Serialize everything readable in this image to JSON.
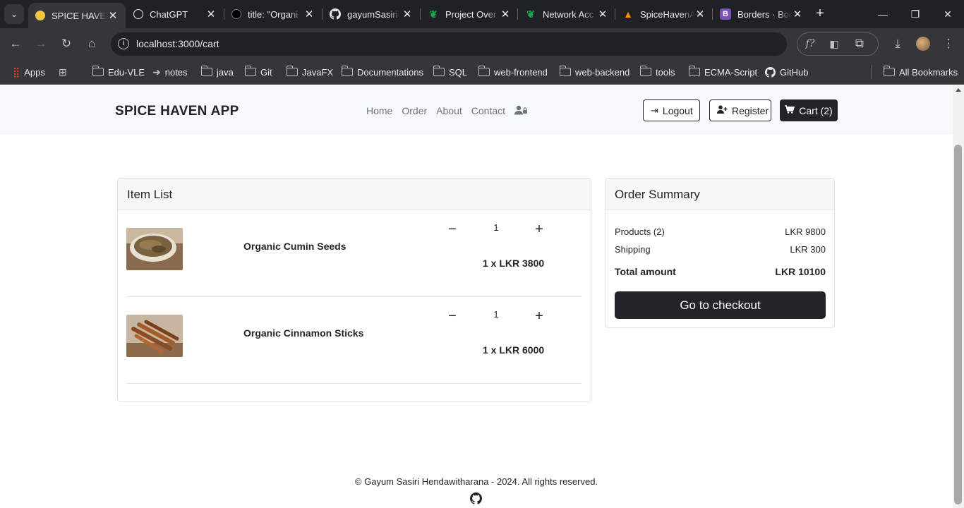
{
  "browser": {
    "tabs": [
      {
        "title": "SPICE HAVEN",
        "active": true,
        "icon": "spice-haven-favicon"
      },
      {
        "title": "ChatGPT",
        "active": false,
        "icon": "chatgpt-favicon"
      },
      {
        "title": "title: \"Organi",
        "active": false,
        "icon": "dark-circle-favicon"
      },
      {
        "title": "gayumSasiri",
        "active": false,
        "icon": "github-favicon"
      },
      {
        "title": "Project Over",
        "active": false,
        "icon": "mongodb-leaf-favicon"
      },
      {
        "title": "Network Acc",
        "active": false,
        "icon": "mongodb-leaf-favicon"
      },
      {
        "title": "SpiceHavenA",
        "active": false,
        "icon": "firebase-favicon"
      },
      {
        "title": "Borders · Boo",
        "active": false,
        "icon": "bootstrap-favicon"
      }
    ],
    "url": "localhost:3000/cart",
    "bookmarks": [
      {
        "label": "Apps",
        "icon": "apps-grid-icon"
      },
      {
        "label": "",
        "icon": "tab-groups-icon"
      },
      {
        "label": "Edu-VLE",
        "icon": "folder-icon"
      },
      {
        "label": "notes",
        "icon": "arrow-icon"
      },
      {
        "label": "java",
        "icon": "folder-icon"
      },
      {
        "label": "Git",
        "icon": "folder-icon"
      },
      {
        "label": "JavaFX",
        "icon": "folder-icon"
      },
      {
        "label": "Documentations",
        "icon": "folder-icon"
      },
      {
        "label": "SQL",
        "icon": "folder-icon"
      },
      {
        "label": "web-frontend",
        "icon": "folder-icon"
      },
      {
        "label": "web-backend",
        "icon": "folder-icon"
      },
      {
        "label": "tools",
        "icon": "folder-icon"
      },
      {
        "label": "ECMA-Script",
        "icon": "folder-icon"
      },
      {
        "label": "GitHub",
        "icon": "github-icon"
      }
    ],
    "all_bookmarks": "All Bookmarks"
  },
  "navbar": {
    "brand": "SPICE HAVEN APP",
    "links": [
      "Home",
      "Order",
      "About",
      "Contact"
    ],
    "logout_label": "Logout",
    "register_label": "Register",
    "cart_label": "Cart (2)"
  },
  "item_list": {
    "title": "Item List",
    "items": [
      {
        "name": "Organic Cumin Seeds",
        "quantity": "1",
        "price": "1 x LKR 3800"
      },
      {
        "name": "Organic Cinnamon Sticks",
        "quantity": "1",
        "price": "1 x LKR 6000"
      }
    ]
  },
  "summary": {
    "title": "Order Summary",
    "products_label": "Products (2)",
    "products_value": "LKR 9800",
    "shipping_label": "Shipping",
    "shipping_value": "LKR 300",
    "total_label": "Total amount",
    "total_value": "LKR 10100",
    "checkout_label": "Go to checkout"
  },
  "footer": {
    "copyright": "© Gayum Sasiri Hendawitharana - 2024. All rights reserved."
  },
  "colors": {
    "browser_dark": "#202124",
    "browser_toolbar": "#35363a",
    "navbar_bg": "#f8f9fa",
    "button_dark": "#212529"
  }
}
